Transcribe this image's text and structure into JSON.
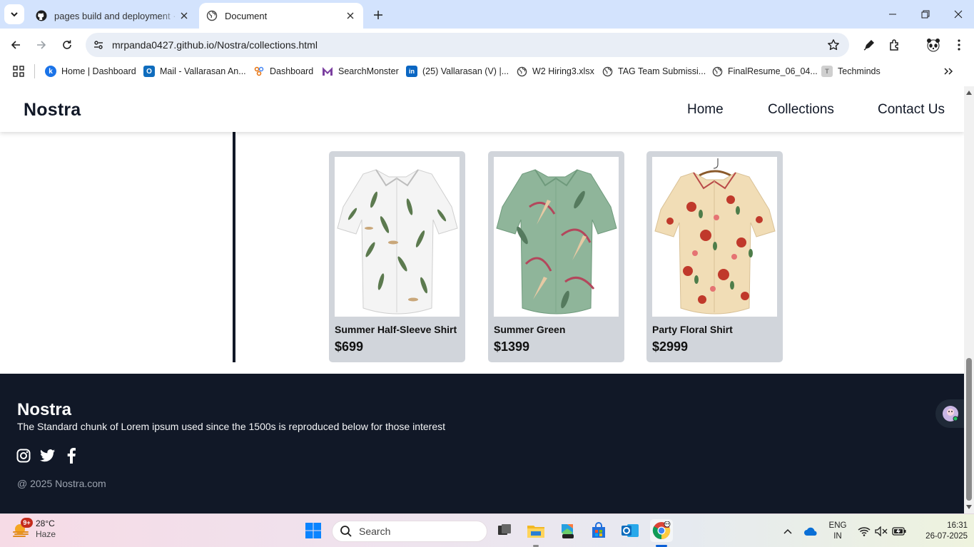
{
  "browser": {
    "tabs": [
      {
        "title": "pages build and deployment · N",
        "active": false
      },
      {
        "title": "Document",
        "active": true
      }
    ],
    "url": {
      "host": "mrpanda0427.github.io",
      "path": "/Nostra/collections.html"
    },
    "bookmarks": [
      {
        "label": "Home | Dashboard",
        "icon": "k-icon",
        "color": "#1a73e8"
      },
      {
        "label": "Mail - Vallarasan An...",
        "icon": "outlook-icon",
        "color": "#0f6cbd"
      },
      {
        "label": "Dashboard",
        "icon": "people-icon",
        "color": "#e8710a"
      },
      {
        "label": "SearchMonster",
        "icon": "m-icon",
        "color": "#7b3fa0"
      },
      {
        "label": "(25) Vallarasan (V) |...",
        "icon": "linkedin-icon",
        "color": "#0a66c2"
      },
      {
        "label": "W2 Hiring3.xlsx",
        "icon": "globe-icon",
        "color": "#5f6368"
      },
      {
        "label": "TAG Team Submissi...",
        "icon": "globe-icon",
        "color": "#5f6368"
      },
      {
        "label": "FinalResume_06_04...",
        "icon": "globe-icon",
        "color": "#5f6368"
      },
      {
        "label": "Techminds",
        "icon": "t-icon",
        "color": "#bdbdbd"
      }
    ]
  },
  "site": {
    "brand": "Nostra",
    "nav": [
      "Home",
      "Collections",
      "Contact Us"
    ]
  },
  "products": [
    {
      "name": "Summer Half-Sleeve Shirt",
      "price": "$699",
      "shirt_color": "#f4f4f4",
      "pattern": "leaf-green"
    },
    {
      "name": "Summer Green",
      "price": "$1399",
      "shirt_color": "#8fb59a",
      "pattern": "tropical-pink"
    },
    {
      "name": "Party Floral Shirt",
      "price": "$2999",
      "shirt_color": "#f1ddb6",
      "pattern": "floral-red"
    }
  ],
  "footer": {
    "brand": "Nostra",
    "tagline": "The Standard chunk of Lorem ipsum used since the 1500s is reproduced below for those interest",
    "social": [
      "instagram-icon",
      "twitter-icon",
      "facebook-icon"
    ],
    "copyright": "@ 2025 Nostra.com"
  },
  "taskbar": {
    "weather": {
      "temp": "28°C",
      "condition": "Haze",
      "badge": "9+"
    },
    "search_label": "Search",
    "tray": {
      "lang": "ENG",
      "region": "IN",
      "time": "16:31",
      "date": "26-07-2025"
    }
  },
  "colors": {
    "footer_bg": "#111827",
    "card_bg": "#d1d5db",
    "tabstrip": "#d3e3fd"
  }
}
